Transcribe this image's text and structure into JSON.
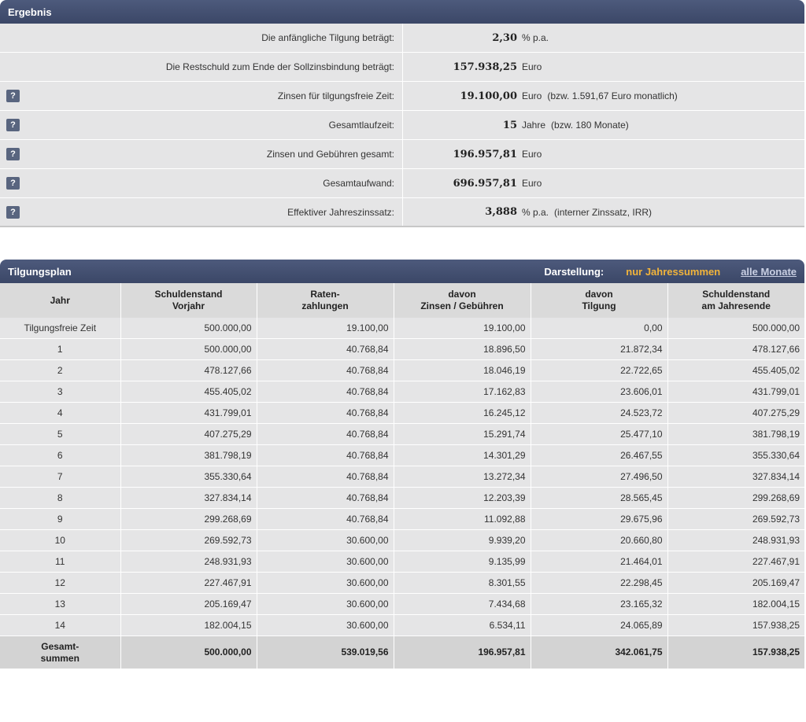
{
  "ergebnis": {
    "title": "Ergebnis",
    "rows": [
      {
        "label": "Die anfängliche Tilgung beträgt:",
        "value": "2,30",
        "unit": "% p.a.",
        "extra": "",
        "help": ""
      },
      {
        "label": "Die Restschuld zum Ende der Sollzinsbindung beträgt:",
        "value": "157.938,25",
        "unit": "Euro",
        "extra": "",
        "help": ""
      },
      {
        "label": "Zinsen für tilgungsfreie Zeit:",
        "value": "19.100,00",
        "unit": "Euro",
        "extra": "(bzw. 1.591,67 Euro monatlich)",
        "help": "?"
      },
      {
        "label": "Gesamtlaufzeit:",
        "value": "15",
        "unit": "Jahre",
        "extra": "(bzw. 180 Monate)",
        "help": "?"
      },
      {
        "label": "Zinsen und Gebühren gesamt:",
        "value": "196.957,81",
        "unit": "Euro",
        "extra": "",
        "help": "?"
      },
      {
        "label": "Gesamtaufwand:",
        "value": "696.957,81",
        "unit": "Euro",
        "extra": "",
        "help": "?"
      },
      {
        "label": "Effektiver Jahreszinssatz:",
        "value": "3,888",
        "unit": "% p.a.",
        "extra": "(interner Zinssatz, IRR)",
        "help": "?"
      }
    ]
  },
  "tilgungsplan": {
    "title": "Tilgungsplan",
    "darstellung_label": "Darstellung:",
    "option_active": "nur Jahressummen",
    "option_link": "alle Monate",
    "columns": [
      {
        "line1": "Jahr",
        "line2": ""
      },
      {
        "line1": "Schuldenstand",
        "line2": "Vorjahr"
      },
      {
        "line1": "Raten-",
        "line2": "zahlungen"
      },
      {
        "line1": "davon",
        "line2": "Zinsen / Gebühren"
      },
      {
        "line1": "davon",
        "line2": "Tilgung"
      },
      {
        "line1": "Schuldenstand",
        "line2": "am Jahresende"
      }
    ],
    "rows": [
      [
        "Tilgungsfreie Zeit",
        "500.000,00",
        "19.100,00",
        "19.100,00",
        "0,00",
        "500.000,00"
      ],
      [
        "1",
        "500.000,00",
        "40.768,84",
        "18.896,50",
        "21.872,34",
        "478.127,66"
      ],
      [
        "2",
        "478.127,66",
        "40.768,84",
        "18.046,19",
        "22.722,65",
        "455.405,02"
      ],
      [
        "3",
        "455.405,02",
        "40.768,84",
        "17.162,83",
        "23.606,01",
        "431.799,01"
      ],
      [
        "4",
        "431.799,01",
        "40.768,84",
        "16.245,12",
        "24.523,72",
        "407.275,29"
      ],
      [
        "5",
        "407.275,29",
        "40.768,84",
        "15.291,74",
        "25.477,10",
        "381.798,19"
      ],
      [
        "6",
        "381.798,19",
        "40.768,84",
        "14.301,29",
        "26.467,55",
        "355.330,64"
      ],
      [
        "7",
        "355.330,64",
        "40.768,84",
        "13.272,34",
        "27.496,50",
        "327.834,14"
      ],
      [
        "8",
        "327.834,14",
        "40.768,84",
        "12.203,39",
        "28.565,45",
        "299.268,69"
      ],
      [
        "9",
        "299.268,69",
        "40.768,84",
        "11.092,88",
        "29.675,96",
        "269.592,73"
      ],
      [
        "10",
        "269.592,73",
        "30.600,00",
        "9.939,20",
        "20.660,80",
        "248.931,93"
      ],
      [
        "11",
        "248.931,93",
        "30.600,00",
        "9.135,99",
        "21.464,01",
        "227.467,91"
      ],
      [
        "12",
        "227.467,91",
        "30.600,00",
        "8.301,55",
        "22.298,45",
        "205.169,47"
      ],
      [
        "13",
        "205.169,47",
        "30.600,00",
        "7.434,68",
        "23.165,32",
        "182.004,15"
      ],
      [
        "14",
        "182.004,15",
        "30.600,00",
        "6.534,11",
        "24.065,89",
        "157.938,25"
      ]
    ],
    "total": {
      "label_line1": "Gesamt-",
      "label_line2": "summen",
      "values": [
        "500.000,00",
        "539.019,56",
        "196.957,81",
        "342.061,75",
        "157.938,25"
      ]
    }
  }
}
